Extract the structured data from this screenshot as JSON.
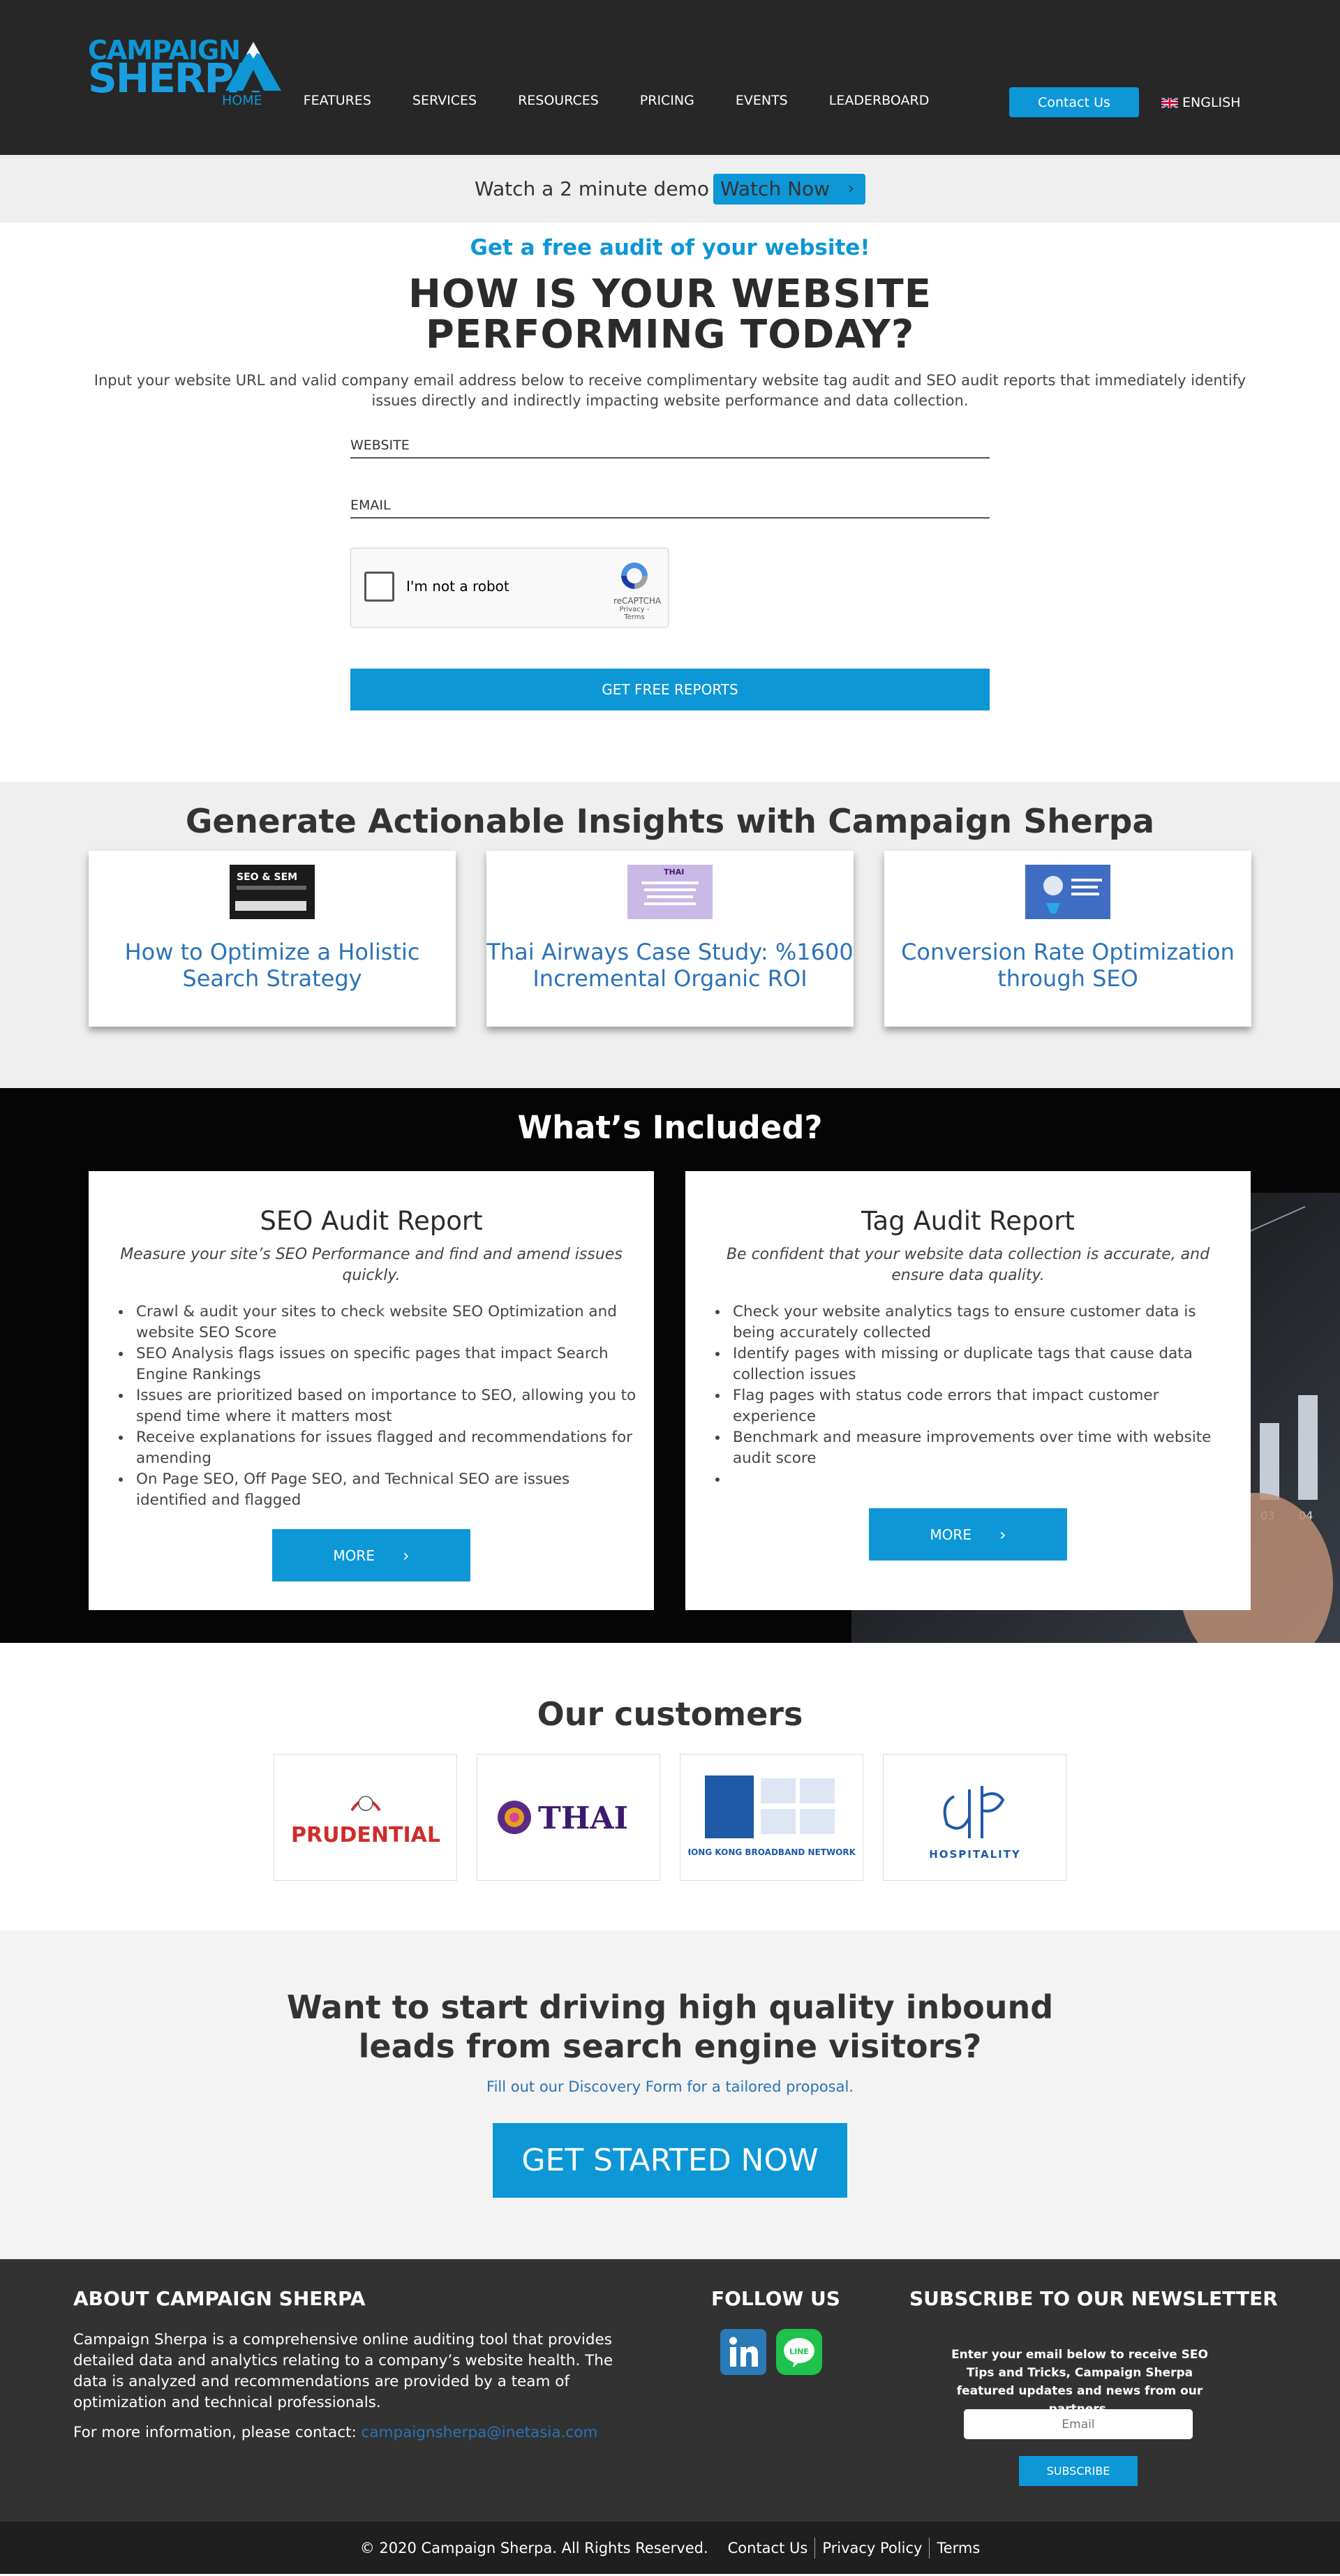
{
  "header": {
    "logo_line1": "CAMPAIGN",
    "logo_line2": "SHERPA",
    "nav": [
      "HOME",
      "FEATURES",
      "SERVICES",
      "RESOURCES",
      "PRICING",
      "EVENTS",
      "LEADERBOARD"
    ],
    "contact_label": "Contact Us",
    "language": "ENGLISH"
  },
  "demo": {
    "text": "Watch a 2 minute demo",
    "button": "Watch Now"
  },
  "audit": {
    "subtitle": "Get a free audit of your website!",
    "title_line1": "HOW IS YOUR WEBSITE",
    "title_line2": "PERFORMING TODAY?",
    "description": "Input your website URL and valid company email address below to receive complimentary website tag audit and SEO audit reports that immediately identify issues directly and indirectly impacting website performance and data collection.",
    "website_placeholder": "WEBSITE",
    "email_placeholder": "EMAIL",
    "captcha_label": "I'm not a robot",
    "captcha_brand": "reCAPTCHA",
    "captcha_links": "Privacy - Terms",
    "submit_label": "GET FREE REPORTS"
  },
  "insights": {
    "title": "Generate Actionable Insights with Campaign Sherpa",
    "cards": [
      {
        "title": "How to Optimize a Holistic Search Strategy",
        "thumb_text": "SEO & SEM"
      },
      {
        "title": "Thai Airways Case Study: %1600 Incremental Organic ROI",
        "thumb_text": "THAI"
      },
      {
        "title": "Conversion Rate Optimization through SEO",
        "thumb_text": ""
      }
    ]
  },
  "included": {
    "title": "What’s Included?",
    "reports": [
      {
        "title": "SEO Audit Report",
        "tagline": "Measure your site’s SEO Performance and find and amend issues quickly.",
        "bullets": [
          "Crawl & audit your sites to check website SEO Optimization and website SEO Score",
          "SEO Analysis flags issues on specific pages that impact Search Engine Rankings",
          "Issues are prioritized based on importance to SEO, allowing you to spend time where it matters most",
          "Receive explanations for issues flagged and recommendations for amending",
          "On Page SEO, Off Page SEO, and Technical SEO are issues identified and flagged"
        ],
        "button": "MORE"
      },
      {
        "title": "Tag Audit Report",
        "tagline": "Be confident that your website data collection is accurate, and ensure data quality.",
        "bullets": [
          "Check your website analytics tags to ensure customer data is being accurately collected",
          "Identify pages with missing or duplicate tags that cause data collection issues",
          "Flag pages with status code errors that impact customer experience",
          "Benchmark and measure improvements over time with website audit score",
          ""
        ],
        "button": "MORE"
      }
    ],
    "bg_labels": [
      "03",
      "04"
    ]
  },
  "customers": {
    "title": "Our customers",
    "logos": [
      "PRUDENTIAL",
      "THAI",
      "HONG KONG BROADBAND NETWORK",
      "HOSPITALITY"
    ]
  },
  "cta": {
    "title_line1": "Want to start driving high quality inbound",
    "title_line2": "leads from search engine visitors?",
    "subtitle": "Fill out our Discovery Form for a tailored proposal.",
    "button": "GET STARTED NOW"
  },
  "footer": {
    "about_title": "ABOUT CAMPAIGN SHERPA",
    "about_text": "Campaign Sherpa is a comprehensive online auditing tool that provides detailed data and analytics relating to a company’s website health. The data is analyzed and recommendations are provided by a team of optimization and technical professionals.",
    "contact_prefix": "For more information, please contact:",
    "contact_email": "campaignsherpa@inetasia.com",
    "follow_title": "FOLLOW US",
    "newsletter_title": "SUBSCRIBE TO OUR NEWSLETTER",
    "newsletter_text": "Enter your email below to receive SEO Tips and Tricks, Campaign Sherpa featured updates and news from our partners.",
    "email_placeholder": "Email",
    "subscribe_label": "SUBSCRIBE"
  },
  "bottom": {
    "copyright": "© 2020 Campaign Sherpa. All Rights Reserved.",
    "links": [
      "Contact Us",
      "Privacy Policy",
      "Terms"
    ]
  },
  "colors": {
    "accent": "#0d97d6",
    "link": "#2b73b6",
    "header_bg": "#272727",
    "footer_bg": "#323232"
  }
}
